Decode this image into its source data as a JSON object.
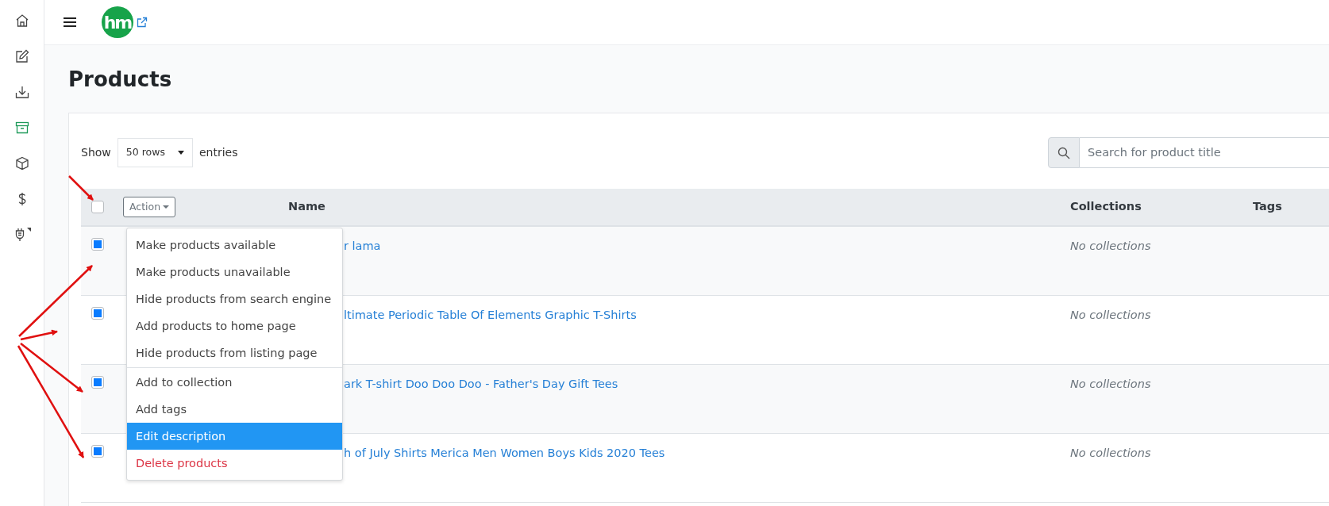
{
  "sidebar": {
    "items": [
      {
        "selected": false
      },
      {
        "selected": false
      },
      {
        "selected": false
      },
      {
        "selected": true
      },
      {
        "selected": false
      },
      {
        "selected": false
      },
      {
        "selected": false
      }
    ]
  },
  "topbar": {
    "logo": "hm"
  },
  "page_title": "Products",
  "show": {
    "label": "Show",
    "value": "50 rows",
    "suffix": "entries"
  },
  "search": {
    "placeholder": "Search for product title"
  },
  "table": {
    "select_all": {
      "checked": false
    },
    "action_button": "Action",
    "columns": [
      "Name",
      "Collections",
      "Tags"
    ],
    "rows": [
      {
        "checked": true,
        "name": "r lama",
        "collections": "No collections"
      },
      {
        "checked": true,
        "name": "ltimate Periodic Table Of Elements Graphic T-Shirts",
        "collections": "No collections"
      },
      {
        "checked": true,
        "name": "ark T-shirt Doo Doo Doo - Father's Day Gift Tees",
        "collections": "No collections"
      },
      {
        "checked": true,
        "name": "h of July Shirts Merica Men Women Boys Kids 2020 Tees",
        "collections": "No collections"
      }
    ]
  },
  "action_menu": {
    "sections": [
      [
        {
          "label": "Make products available",
          "kind": "normal",
          "selected": false
        },
        {
          "label": "Make products unavailable",
          "kind": "normal",
          "selected": false
        },
        {
          "label": "Hide products from search engine",
          "kind": "normal",
          "selected": false
        },
        {
          "label": "Add products to home page",
          "kind": "normal",
          "selected": false
        },
        {
          "label": "Hide products from listing page",
          "kind": "normal",
          "selected": false
        }
      ],
      [
        {
          "label": "Add to collection",
          "kind": "normal",
          "selected": false
        },
        {
          "label": "Add tags",
          "kind": "normal",
          "selected": false
        },
        {
          "label": "Edit description",
          "kind": "normal",
          "selected": true
        },
        {
          "label": "Delete products",
          "kind": "danger",
          "selected": false
        }
      ]
    ]
  }
}
